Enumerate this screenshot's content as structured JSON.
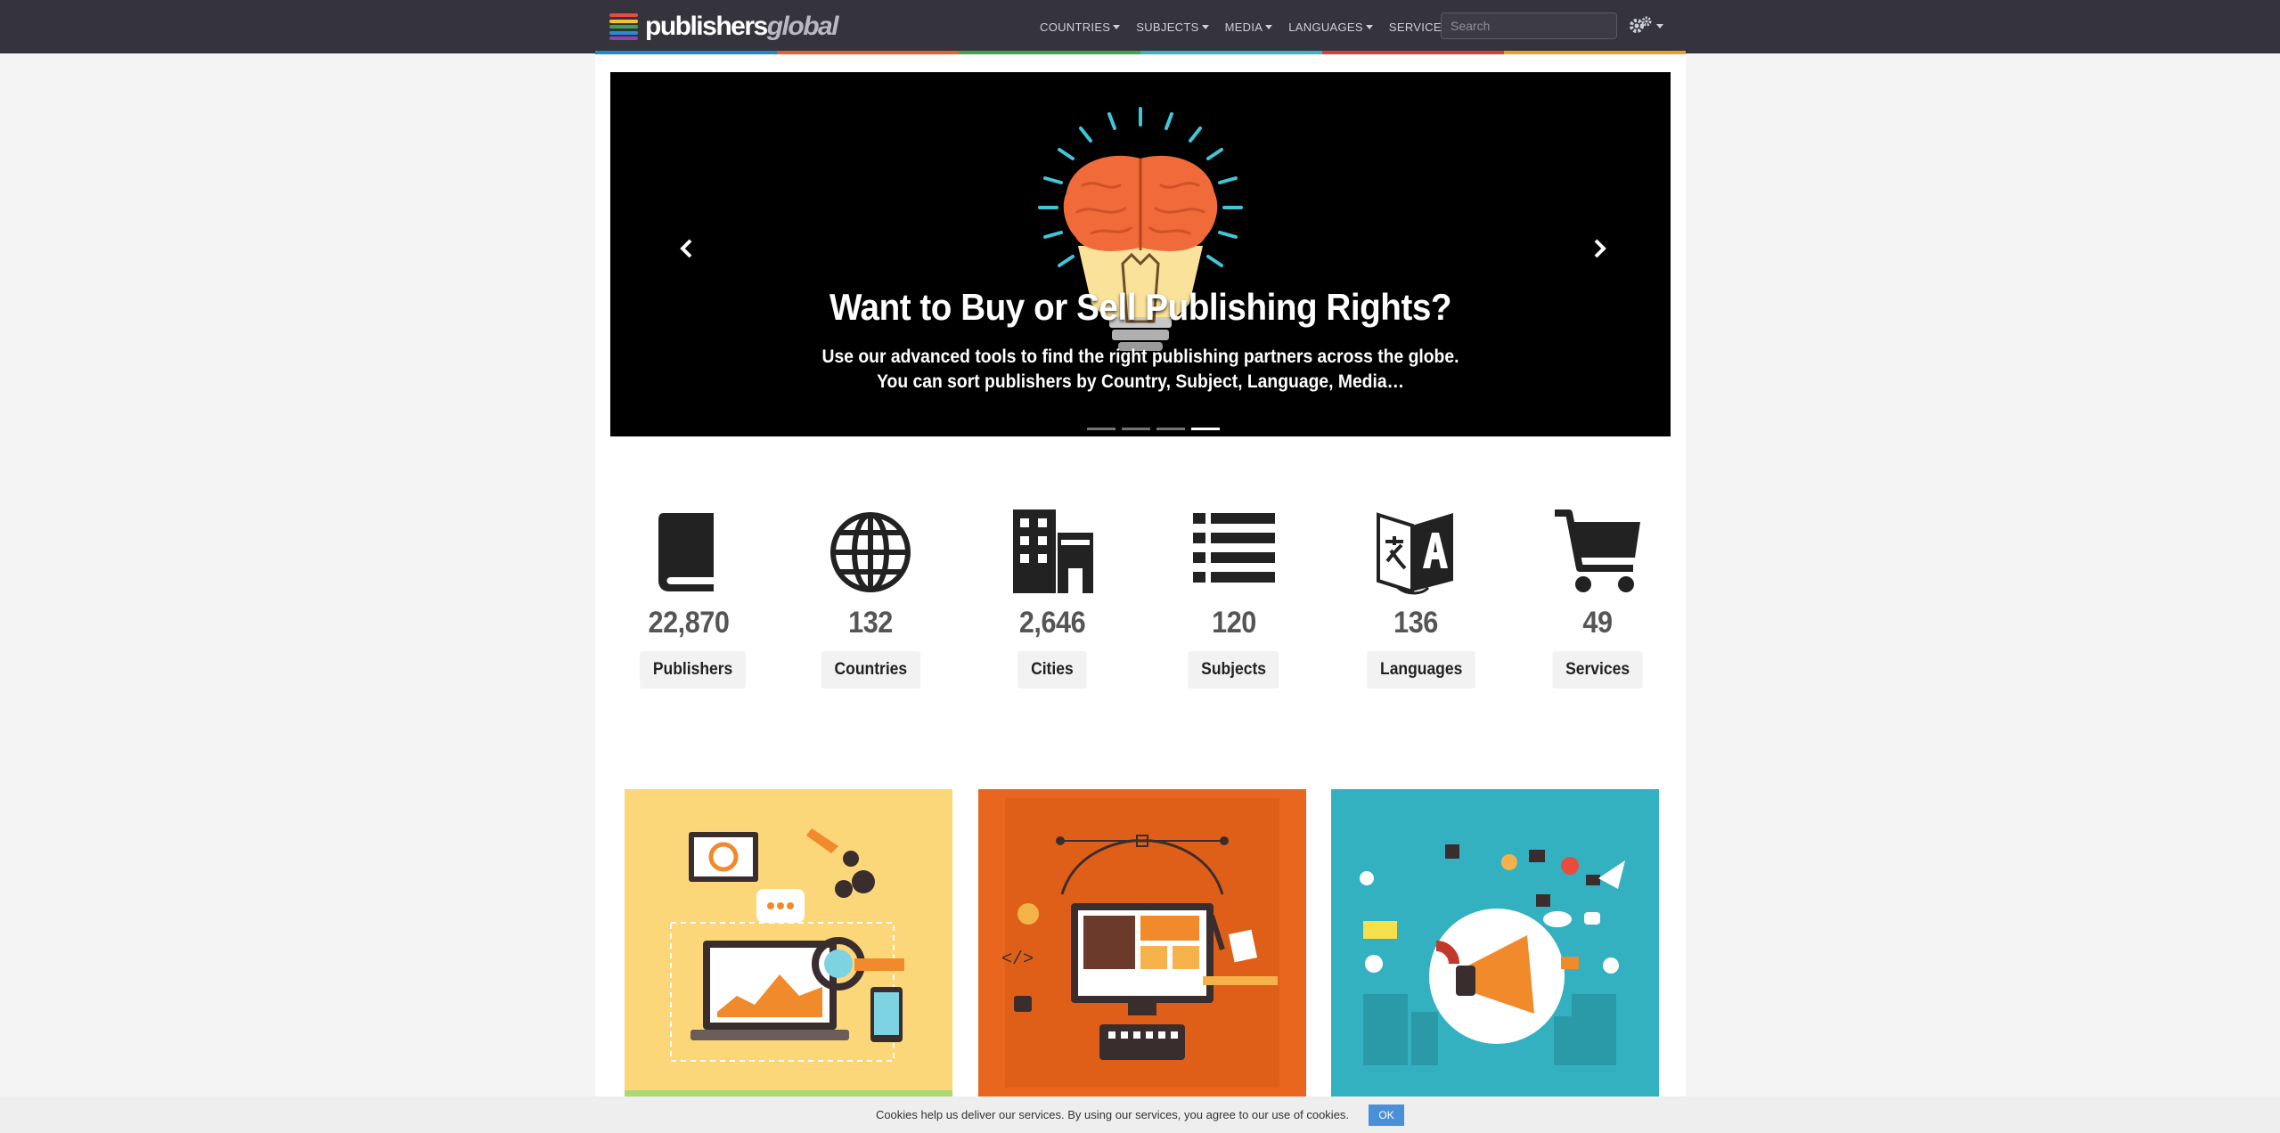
{
  "brand": {
    "name_part1": "publishers",
    "name_part2": "global",
    "logo_colors": [
      "#e94b3c",
      "#f4c430",
      "#3aa655",
      "#2e86de",
      "#8e44ad"
    ]
  },
  "nav": {
    "items": [
      {
        "label": "COUNTRIES"
      },
      {
        "label": "SUBJECTS"
      },
      {
        "label": "MEDIA"
      },
      {
        "label": "LANGUAGES"
      },
      {
        "label": "SERVICES"
      }
    ],
    "search_placeholder": "Search",
    "settings_icon": "gears-icon",
    "strip_colors": [
      "#1e88c9",
      "#e2622c",
      "#42a548",
      "#38b4c8",
      "#d8403a",
      "#e6a126"
    ]
  },
  "carousel": {
    "title": "Want to Buy or Sell Publishing Rights?",
    "text": "Use our advanced tools to find the right publishing partners across the globe. You can sort publishers by Country, Subject, Language, Media…",
    "slides_count": 4,
    "active_slide": 4
  },
  "stats": [
    {
      "icon": "book-icon",
      "value": "22,870",
      "label": "Publishers"
    },
    {
      "icon": "globe-icon",
      "value": "132",
      "label": "Countries"
    },
    {
      "icon": "buildings-icon",
      "value": "2,646",
      "label": "Cities"
    },
    {
      "icon": "list-icon",
      "value": "120",
      "label": "Subjects"
    },
    {
      "icon": "translate-icon",
      "value": "136",
      "label": "Languages"
    },
    {
      "icon": "cart-icon",
      "value": "49",
      "label": "Services"
    }
  ],
  "cards": [
    {
      "name": "web-analytics-card",
      "bg": "#fbd77a"
    },
    {
      "name": "web-design-card",
      "bg": "#e9661e"
    },
    {
      "name": "marketing-card",
      "bg": "#34b1c1"
    }
  ],
  "cookie": {
    "text": "Cookies help us deliver our services. By using our services, you agree to our use of cookies.",
    "ok_label": "OK"
  }
}
